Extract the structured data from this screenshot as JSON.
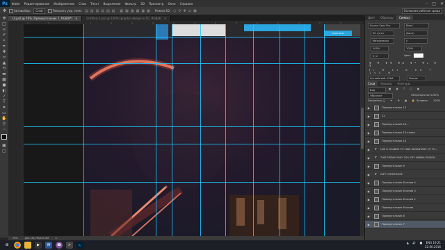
{
  "app": {
    "logo": "Ps"
  },
  "menu": [
    "Файл",
    "Редактирование",
    "Изображение",
    "Слои",
    "Текст",
    "Выделение",
    "Фильтр",
    "3D",
    "Просмотр",
    "Окно",
    "Справка"
  ],
  "options": {
    "autoselect_label": "Автовыбор:",
    "autoselect_value": "Слой",
    "transform_label": "Показать упр. элем.",
    "mode_label": "Режим 3D:"
  },
  "workspace": "Основная рабочая среда",
  "tabs": [
    {
      "label": "Ui.psd @ 76% (Прямоугольник 7, RGB/8*)",
      "active": true
    },
    {
      "label": "Untitled-1.psd @ 100% (graphic-design-in-5C, RGB/8)",
      "active": false
    }
  ],
  "canvas_ad": {
    "button": "SHOP NOW"
  },
  "status": {
    "zoom": "76%",
    "doc": "Док: 26,7M/143,4M"
  },
  "panel_top": {
    "tabs": [
      "Цвет",
      "Образцы",
      "Символ"
    ],
    "active_tab": 2,
    "font": "Source Sans Pro",
    "style": "Black",
    "size": "30 пункт",
    "leading": "(Авто)",
    "tracking": "Метрически",
    "kerning": "0",
    "scale_v": "100%",
    "scale_h": "100%",
    "baseline": "0 пт",
    "color_label": "Цвет:",
    "lang": "Английский: США",
    "aa": "Резкое"
  },
  "layers_panel": {
    "tabs": [
      "Слои",
      "Каналы",
      "Контуры"
    ],
    "active_tab": 0,
    "kind": "Вид",
    "blend": "Обычные",
    "opacity_label": "Непрозрачность:",
    "opacity": "90%",
    "lock_label": "Закрепить:",
    "fill_label": "Заливка:",
    "fill": "100%",
    "layers": [
      {
        "type": "shape",
        "name": "Прямоугольник 12"
      },
      {
        "type": "shape",
        "name": "13"
      },
      {
        "type": "shape",
        "name": "Прямоугольник 12..."
      },
      {
        "type": "shape",
        "name": "Прямоугольник 10 копия"
      },
      {
        "type": "shape",
        "name": "Прямоугольник 10"
      },
      {
        "type": "text",
        "name": "USE A CHANGE TO TAKE ADVANTAGE OF TH..."
      },
      {
        "type": "text",
        "name": "THIS FRIDAY ONLY 20% OFF HENNA DESIGN"
      },
      {
        "type": "shape",
        "name": "Прямоугольник 9"
      },
      {
        "type": "text",
        "name": "GIFT CERTIFICATE"
      },
      {
        "type": "shape",
        "name": "Прямоугольник 8 копия 4"
      },
      {
        "type": "shape",
        "name": "Прямоугольник 8 копия 3"
      },
      {
        "type": "shape",
        "name": "Прямоугольник 8 копия 2"
      },
      {
        "type": "shape",
        "name": "Прямоугольник 8 копия"
      },
      {
        "type": "shape",
        "name": "Прямоугольник 8"
      },
      {
        "type": "shape",
        "name": "Прямоугольник 7"
      }
    ],
    "selected_index": 14
  },
  "taskbar": {
    "time": "19:21",
    "date": "22.06.2016",
    "lang": "ENG"
  },
  "colors": {
    "guide": "#1ec8ff",
    "accent": "#31a8ff",
    "canvas_bg": "#1a1d2a",
    "button": "#2aa6e0"
  }
}
